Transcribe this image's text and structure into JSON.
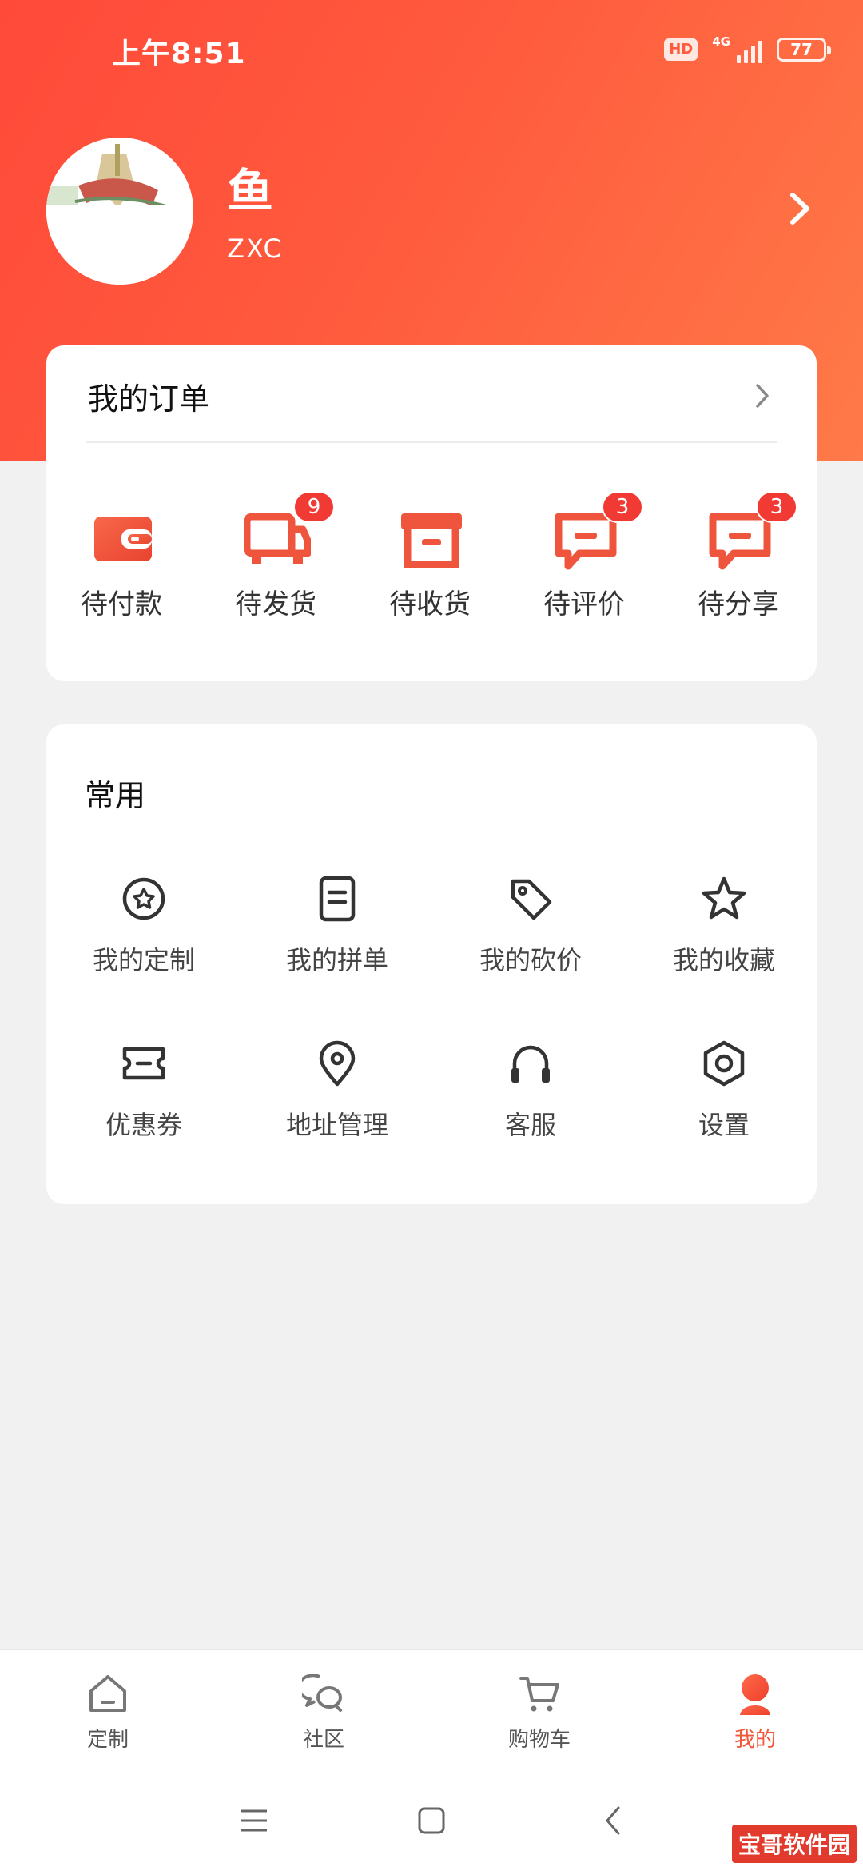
{
  "status_bar": {
    "time": "上午8:51",
    "hd": "HD",
    "network": "4G",
    "battery": "77"
  },
  "profile": {
    "name": "鱼",
    "id": "ZXC"
  },
  "orders": {
    "title": "我的订单",
    "items": [
      {
        "label": "待付款",
        "icon": "wallet-icon",
        "badge": ""
      },
      {
        "label": "待发货",
        "icon": "truck-icon",
        "badge": "9"
      },
      {
        "label": "待收货",
        "icon": "box-icon",
        "badge": ""
      },
      {
        "label": "待评价",
        "icon": "comment-icon",
        "badge": "3"
      },
      {
        "label": "待分享",
        "icon": "share-comment-icon",
        "badge": "3"
      }
    ]
  },
  "common": {
    "title": "常用",
    "items": [
      {
        "label": "我的定制",
        "icon": "custom-badge-icon"
      },
      {
        "label": "我的拼单",
        "icon": "document-icon"
      },
      {
        "label": "我的砍价",
        "icon": "tag-icon"
      },
      {
        "label": "我的收藏",
        "icon": "star-icon"
      },
      {
        "label": "优惠券",
        "icon": "ticket-icon"
      },
      {
        "label": "地址管理",
        "icon": "location-pin-icon"
      },
      {
        "label": "客服",
        "icon": "headphones-icon"
      },
      {
        "label": "设置",
        "icon": "settings-icon"
      }
    ]
  },
  "bottom_nav": {
    "items": [
      {
        "label": "定制",
        "icon": "home-icon",
        "active": false
      },
      {
        "label": "社区",
        "icon": "chat-bubbles-icon",
        "active": false
      },
      {
        "label": "购物车",
        "icon": "cart-icon",
        "active": false
      },
      {
        "label": "我的",
        "icon": "profile-icon",
        "active": true
      }
    ]
  },
  "colors": {
    "accent": "#f2573a",
    "badge": "#f23a34",
    "header_start": "#ff4a3a",
    "header_end": "#ff7a48"
  },
  "watermark": "宝哥软件园"
}
